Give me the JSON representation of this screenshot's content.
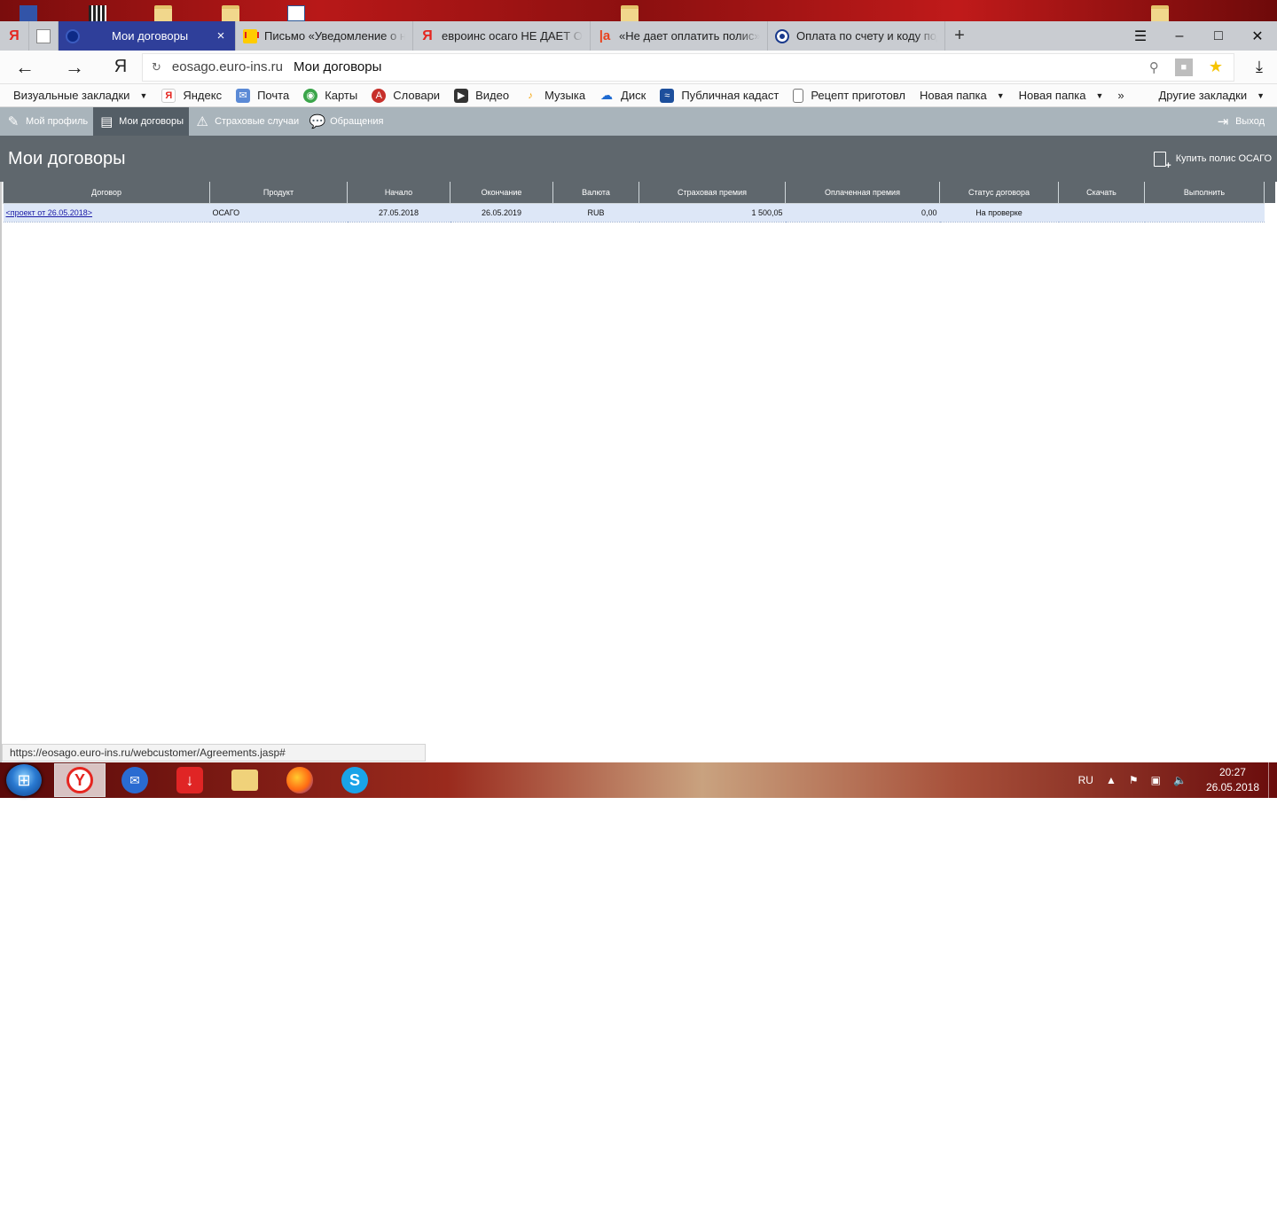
{
  "browser": {
    "tabs": [
      {
        "label": "Мои договоры",
        "favicon": "euroins-icon",
        "active": true
      },
      {
        "label": "Письмо «Уведомление о не",
        "favicon": "yandex-mail-icon"
      },
      {
        "label": "евроинс осаго НЕ ДАЕТ ОП",
        "favicon": "yandex-icon"
      },
      {
        "label": "«Не дает оплатить полис» -",
        "favicon": "irecommend-icon"
      },
      {
        "label": "Оплата по счету и коду под",
        "favicon": "globe-icon"
      }
    ],
    "pinned_tab_letter": "Я",
    "nav_logo": "Я",
    "address": {
      "domain": "eosago.euro-ins.ru",
      "title": "Мои договоры"
    },
    "bookmarks": [
      {
        "label": "Визуальные закладки",
        "dropdown": true,
        "icon": ""
      },
      {
        "label": "Яндекс",
        "icon": "yandex-icon"
      },
      {
        "label": "Почта",
        "icon": "mail-icon"
      },
      {
        "label": "Карты",
        "icon": "maps-icon"
      },
      {
        "label": "Словари",
        "icon": "dictionary-icon"
      },
      {
        "label": "Видео",
        "icon": "video-icon"
      },
      {
        "label": "Музыка",
        "icon": "music-icon"
      },
      {
        "label": "Диск",
        "icon": "disk-icon"
      },
      {
        "label": "Публичная кадаст",
        "icon": "cadastre-icon"
      },
      {
        "label": "Рецепт приготовл",
        "icon": "document-icon"
      },
      {
        "label": "Новая папка",
        "dropdown": true,
        "icon": ""
      },
      {
        "label": "Новая папка",
        "dropdown": true,
        "icon": ""
      }
    ],
    "more_bookmarks": "»",
    "other_bookmarks": "Другие закладки"
  },
  "site_nav": {
    "items": [
      {
        "label": "Мой профиль",
        "icon": "user-edit-icon",
        "active": false
      },
      {
        "label": "Мои договоры",
        "icon": "document-icon",
        "active": true
      },
      {
        "label": "Страховые случаи",
        "icon": "warning-icon",
        "active": false
      },
      {
        "label": "Обращения",
        "icon": "chat-icon",
        "active": false
      }
    ],
    "logout": "Выход"
  },
  "page": {
    "title": "Мои договоры",
    "buy_button": "Купить полис ОСАГО"
  },
  "table": {
    "headers": [
      "Договор",
      "Продукт",
      "Начало",
      "Окончание",
      "Валюта",
      "Страховая премия",
      "Оплаченная премия",
      "Статус договора",
      "Скачать",
      "Выполнить"
    ],
    "rows": [
      {
        "agreement": "<проект от 26.05.2018>",
        "product": "ОСАГО",
        "start": "27.05.2018",
        "end": "26.05.2019",
        "currency": "RUB",
        "premium": "1 500,05",
        "paid": "0,00",
        "status": "На проверке",
        "download": "",
        "action": ""
      }
    ]
  },
  "status_url": "https://eosago.euro-ins.ru/webcustomer/Agreements.jasp#",
  "taskbar": {
    "apps": [
      "yandex-browser",
      "thunderbird",
      "download-master",
      "file-explorer",
      "firefox",
      "skype"
    ],
    "lang": "RU",
    "time": "20:27",
    "date": "26.05.2018"
  },
  "colors": {
    "tab_active": "#2f3f9a",
    "site_nav_bg": "#a9b4bb",
    "header_bg": "#5f676d",
    "row_bg": "#dde7f7",
    "link": "#1a1aa6"
  }
}
